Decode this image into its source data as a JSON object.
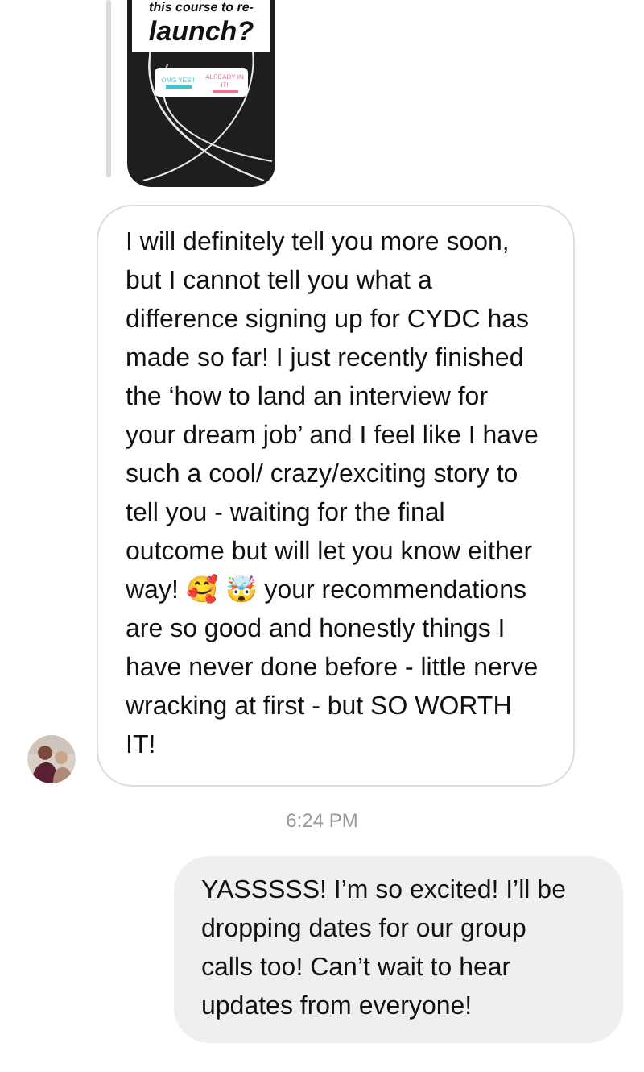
{
  "story": {
    "kind": "picture",
    "caption_lines": [
      "this course to re-",
      "launch?"
    ],
    "poll_options": [
      {
        "label": "OMG YES!!",
        "color": "#3cc6c9"
      },
      {
        "label": "ALREADY IN IT!",
        "color": "#f0708c"
      }
    ]
  },
  "messages": [
    {
      "kind": "incoming",
      "text": "I will definitely tell you more soon, but I cannot tell you what a difference signing up for CYDC has made so far! I just recently finished the ‘how to land an interview for your dream job’ and I feel like I have such a cool/ crazy/exciting story to tell you - waiting for the final outcome but will let you know either way! 🥰 🤯 your recommendations are so good and honestly things I have never done before - little nerve wracking at first - but SO WORTH IT!"
    },
    {
      "kind": "timestamp",
      "text": "6:24 PM"
    },
    {
      "kind": "outgoing",
      "text": "YASSSSS! I’m so excited! I’ll be dropping dates for our group calls too! Can’t wait to hear updates from everyone!"
    }
  ]
}
